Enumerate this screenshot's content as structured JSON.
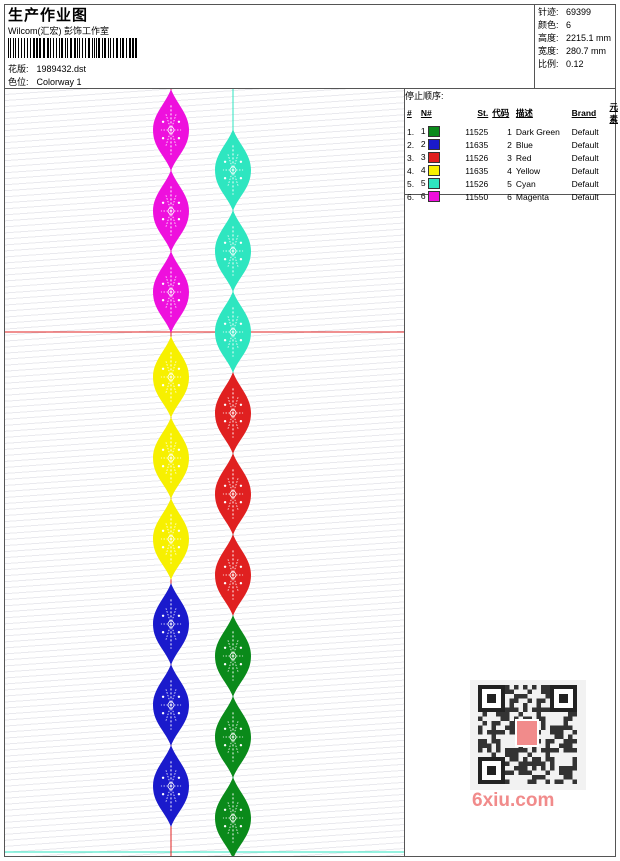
{
  "header": {
    "title": "生产作业图",
    "subtitle": "Wilcom(汇宏) 彭饰工作室",
    "design_label": "花版:",
    "design_value": "1989432.dst",
    "colorway_label": "色位:",
    "colorway_value": "Colorway 1"
  },
  "stats": [
    {
      "label": "针迹:",
      "value": "69399"
    },
    {
      "label": "颜色:",
      "value": "6"
    },
    {
      "label": "高度:",
      "value": "2215.1 mm"
    },
    {
      "label": "宽度:",
      "value": "280.7 mm"
    },
    {
      "label": "比例:",
      "value": "0.12"
    }
  ],
  "stop_sequence": {
    "title": "停止顺序:",
    "columns": [
      "#",
      "N#",
      "St.",
      "代码",
      "描述",
      "Brand",
      "元素"
    ],
    "rows": [
      {
        "num": "1.",
        "n": "1",
        "color": "#0a8a1a",
        "st": "11525",
        "code": "1",
        "desc": "Dark Green",
        "brand": "Default"
      },
      {
        "num": "2.",
        "n": "2",
        "color": "#1a1acc",
        "st": "11635",
        "code": "2",
        "desc": "Blue",
        "brand": "Default"
      },
      {
        "num": "3.",
        "n": "3",
        "color": "#e02020",
        "st": "11526",
        "code": "3",
        "desc": "Red",
        "brand": "Default"
      },
      {
        "num": "4.",
        "n": "4",
        "color": "#f7f000",
        "st": "11635",
        "code": "4",
        "desc": "Yellow",
        "brand": "Default"
      },
      {
        "num": "5.",
        "n": "5",
        "color": "#2ee6c0",
        "st": "11526",
        "code": "5",
        "desc": "Cyan",
        "brand": "Default"
      },
      {
        "num": "6.",
        "n": "6",
        "color": "#ee10dd",
        "st": "11550",
        "code": "6",
        "desc": "Magenta",
        "brand": "Default"
      }
    ]
  },
  "design": {
    "left_column": [
      "#ee10dd",
      "#ee10dd",
      "#ee10dd",
      "#f7f000",
      "#f7f000",
      "#f7f000",
      "#1a1acc",
      "#1a1acc",
      "#1a1acc"
    ],
    "right_column": [
      "#2ee6c0",
      "#2ee6c0",
      "#2ee6c0",
      "#e02020",
      "#e02020",
      "#e02020",
      "#0a8a1a",
      "#0a8a1a",
      "#0a8a1a"
    ]
  },
  "watermark": "6xiu.com"
}
